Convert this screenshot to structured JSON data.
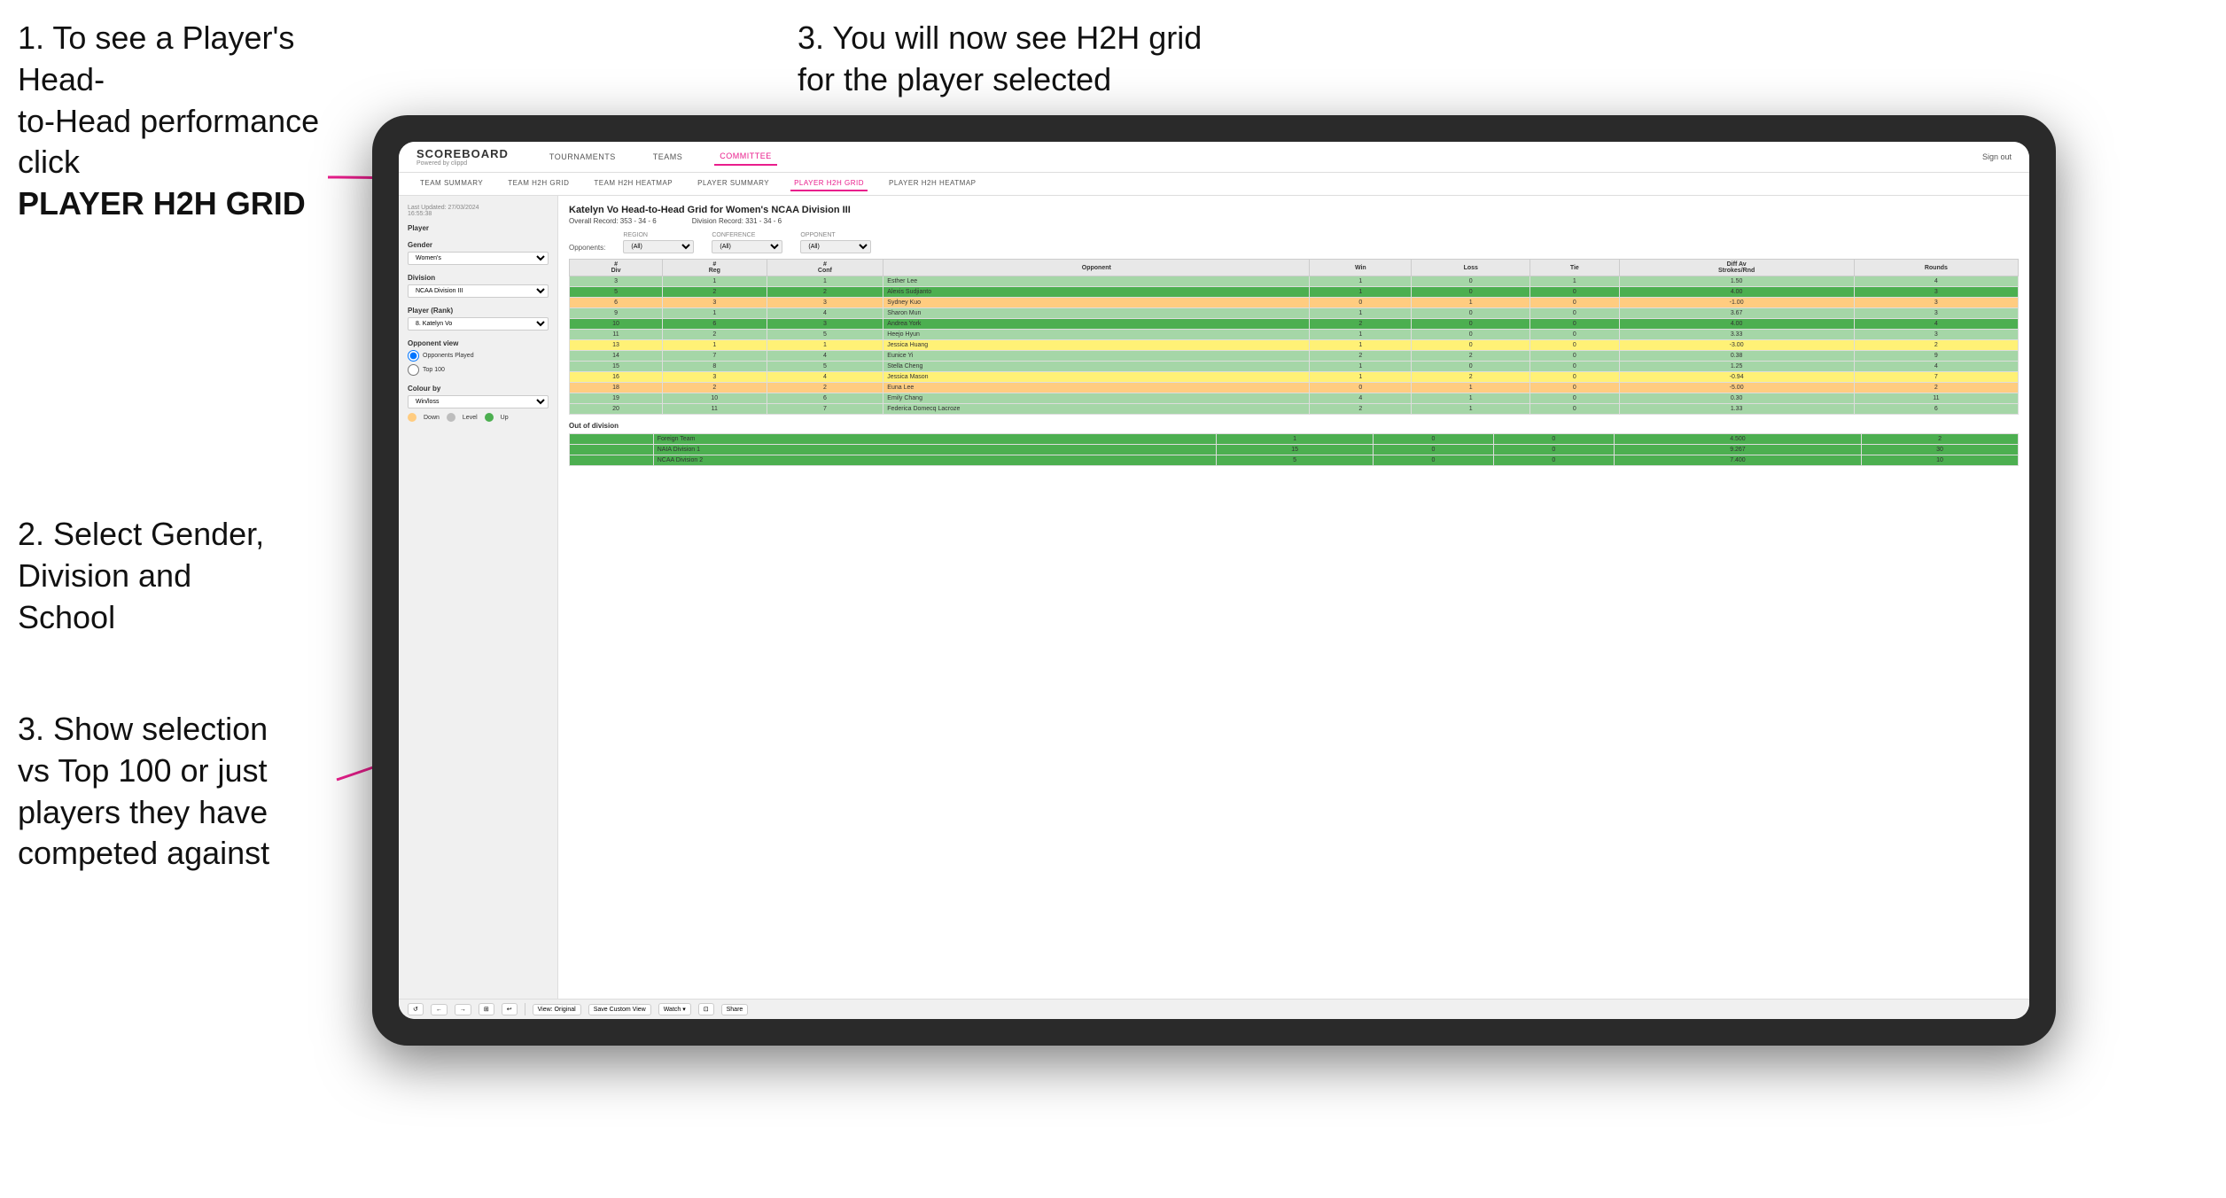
{
  "page": {
    "bg": "#ffffff"
  },
  "instructions": {
    "top_left_1": "1. To see a Player's Head-",
    "top_left_2": "to-Head performance click",
    "top_left_bold": "PLAYER H2H GRID",
    "top_right": "3. You will now see H2H grid\nfor the player selected",
    "bottom_left_1": "2. Select Gender,\nDivision and\nSchool",
    "bottom_left_2": "3. Show selection\nvs Top 100 or just\nplayers they have\ncompeted against"
  },
  "navbar": {
    "logo": "SCOREBOARD",
    "logo_sub": "Powered by clippd",
    "nav_items": [
      "TOURNAMENTS",
      "TEAMS",
      "COMMITTEE"
    ],
    "active_nav": "COMMITTEE",
    "nav_right": "Sign out"
  },
  "subnav": {
    "items": [
      "TEAM SUMMARY",
      "TEAM H2H GRID",
      "TEAM H2H HEATMAP",
      "PLAYER SUMMARY",
      "PLAYER H2H GRID",
      "PLAYER H2H HEATMAP"
    ],
    "active": "PLAYER H2H GRID"
  },
  "sidebar": {
    "timestamp": "Last Updated: 27/03/2024\n16:55:38",
    "player_label": "Player",
    "gender_label": "Gender",
    "gender_value": "Women's",
    "division_label": "Division",
    "division_value": "NCAA Division III",
    "player_rank_label": "Player (Rank)",
    "player_rank_value": "8. Katelyn Vo",
    "opponent_view_label": "Opponent view",
    "opponent_options": [
      "Opponents Played",
      "Top 100"
    ],
    "opponent_selected": "Opponents Played",
    "colour_by_label": "Colour by",
    "colour_by_value": "Win/loss",
    "legend": [
      {
        "label": "Down",
        "color": "#ffcc80"
      },
      {
        "label": "Level",
        "color": "#bdbdbd"
      },
      {
        "label": "Up",
        "color": "#4caf50"
      }
    ]
  },
  "grid": {
    "title": "Katelyn Vo Head-to-Head Grid for Women's NCAA Division III",
    "overall_record": "Overall Record: 353 - 34 - 6",
    "division_record": "Division Record: 331 - 34 - 6",
    "filters": {
      "opponents_label": "Opponents:",
      "region_label": "Region",
      "region_value": "(All)",
      "conference_label": "Conference",
      "conference_value": "(All)",
      "opponent_label": "Opponent",
      "opponent_value": "(All)"
    },
    "columns": [
      "#\nDiv",
      "#\nReg",
      "#\nConf",
      "Opponent",
      "Win",
      "Loss",
      "Tie",
      "Diff Av\nStrokes/Rnd",
      "Rounds"
    ],
    "rows": [
      {
        "div": 3,
        "reg": 1,
        "conf": 1,
        "opponent": "Esther Lee",
        "win": 1,
        "loss": 0,
        "tie": 1,
        "diff": 1.5,
        "rounds": 4,
        "color": "green-light"
      },
      {
        "div": 5,
        "reg": 2,
        "conf": 2,
        "opponent": "Alexis Sudjianto",
        "win": 1,
        "loss": 0,
        "tie": 0,
        "diff": 4.0,
        "rounds": 3,
        "color": "green-dark"
      },
      {
        "div": 6,
        "reg": 3,
        "conf": 3,
        "opponent": "Sydney Kuo",
        "win": 0,
        "loss": 1,
        "tie": 0,
        "diff": -1.0,
        "rounds": 3,
        "color": "orange"
      },
      {
        "div": 9,
        "reg": 1,
        "conf": 4,
        "opponent": "Sharon Mun",
        "win": 1,
        "loss": 0,
        "tie": 0,
        "diff": 3.67,
        "rounds": 3,
        "color": "green-light"
      },
      {
        "div": 10,
        "reg": 6,
        "conf": 3,
        "opponent": "Andrea York",
        "win": 2,
        "loss": 0,
        "tie": 0,
        "diff": 4.0,
        "rounds": 4,
        "color": "green-dark"
      },
      {
        "div": 11,
        "reg": 2,
        "conf": 5,
        "opponent": "Heejo Hyun",
        "win": 1,
        "loss": 0,
        "tie": 0,
        "diff": 3.33,
        "rounds": 3,
        "color": "green-light"
      },
      {
        "div": 13,
        "reg": 1,
        "conf": 1,
        "opponent": "Jessica Huang",
        "win": 1,
        "loss": 0,
        "tie": 0,
        "diff": -3.0,
        "rounds": 2,
        "color": "yellow"
      },
      {
        "div": 14,
        "reg": 7,
        "conf": 4,
        "opponent": "Eunice Yi",
        "win": 2,
        "loss": 2,
        "tie": 0,
        "diff": 0.38,
        "rounds": 9,
        "color": "green-light"
      },
      {
        "div": 15,
        "reg": 8,
        "conf": 5,
        "opponent": "Stella Cheng",
        "win": 1,
        "loss": 0,
        "tie": 0,
        "diff": 1.25,
        "rounds": 4,
        "color": "green-light"
      },
      {
        "div": 16,
        "reg": 3,
        "conf": 4,
        "opponent": "Jessica Mason",
        "win": 1,
        "loss": 2,
        "tie": 0,
        "diff": -0.94,
        "rounds": 7,
        "color": "yellow"
      },
      {
        "div": 18,
        "reg": 2,
        "conf": 2,
        "opponent": "Euna Lee",
        "win": 0,
        "loss": 1,
        "tie": 0,
        "diff": -5.0,
        "rounds": 2,
        "color": "orange"
      },
      {
        "div": 19,
        "reg": 10,
        "conf": 6,
        "opponent": "Emily Chang",
        "win": 4,
        "loss": 1,
        "tie": 0,
        "diff": 0.3,
        "rounds": 11,
        "color": "green-light"
      },
      {
        "div": 20,
        "reg": 11,
        "conf": 7,
        "opponent": "Federica Domecq Lacroze",
        "win": 2,
        "loss": 1,
        "tie": 0,
        "diff": 1.33,
        "rounds": 6,
        "color": "green-light"
      }
    ],
    "out_of_division_label": "Out of division",
    "out_of_division_rows": [
      {
        "label": "Foreign Team",
        "win": 1,
        "loss": 0,
        "tie": 0,
        "diff": 4.5,
        "rounds": 2,
        "color": "green-dark"
      },
      {
        "label": "NAIA Division 1",
        "win": 15,
        "loss": 0,
        "tie": 0,
        "diff": 9.267,
        "rounds": 30,
        "color": "green-dark"
      },
      {
        "label": "NCAA Division 2",
        "win": 5,
        "loss": 0,
        "tie": 0,
        "diff": 7.4,
        "rounds": 10,
        "color": "green-dark"
      }
    ]
  },
  "toolbar": {
    "buttons": [
      "↺",
      "←",
      "→",
      "⊞",
      "↩",
      "·",
      "⊙",
      "View: Original",
      "Save Custom View",
      "Watch ▾",
      "⊡",
      "⋮⋮",
      "Share"
    ]
  }
}
